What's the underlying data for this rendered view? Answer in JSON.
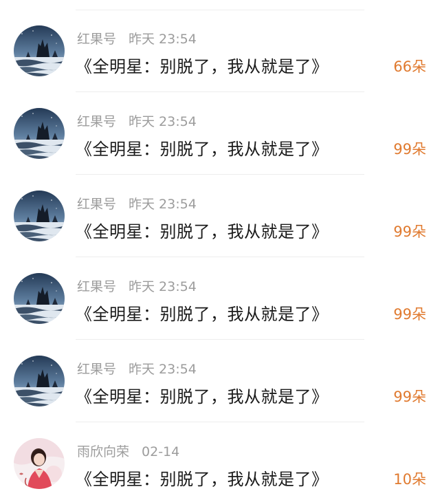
{
  "items": [
    {
      "author": "红果号",
      "time": "昨天 23:54",
      "title": "《全明星：别脱了，我从就是了》",
      "count": "66朵",
      "avatar_icon": "rock-seascape-avatar"
    },
    {
      "author": "红果号",
      "time": "昨天 23:54",
      "title": "《全明星：别脱了，我从就是了》",
      "count": "99朵",
      "avatar_icon": "rock-seascape-avatar"
    },
    {
      "author": "红果号",
      "time": "昨天 23:54",
      "title": "《全明星：别脱了，我从就是了》",
      "count": "99朵",
      "avatar_icon": "rock-seascape-avatar"
    },
    {
      "author": "红果号",
      "time": "昨天 23:54",
      "title": "《全明星：别脱了，我从就是了》",
      "count": "99朵",
      "avatar_icon": "rock-seascape-avatar"
    },
    {
      "author": "红果号",
      "time": "昨天 23:54",
      "title": "《全明星：别脱了，我从就是了》",
      "count": "99朵",
      "avatar_icon": "rock-seascape-avatar"
    },
    {
      "author": "雨欣向荣",
      "time": "02-14",
      "title": "《全明星：别脱了，我从就是了》",
      "count": "10朵",
      "avatar_icon": "portrait-avatar"
    }
  ],
  "colors": {
    "count": "#e07a2f",
    "meta": "#9c9c9c",
    "title": "#1a1a1a",
    "divider": "#ededed"
  }
}
